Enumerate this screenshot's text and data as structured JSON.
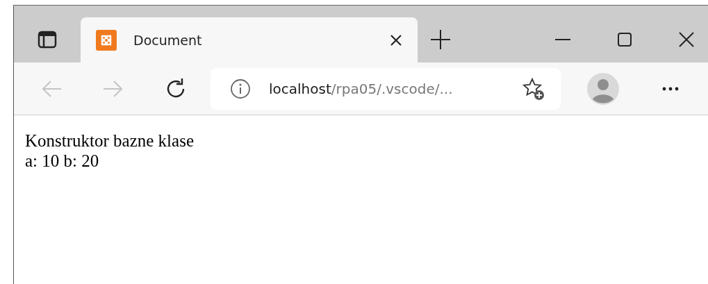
{
  "tabs": [
    {
      "title": "Document",
      "selected": true
    }
  ],
  "address_bar": {
    "host": "localhost",
    "path": "/rpa05/.vscode/..."
  },
  "navigation": {
    "back_disabled": true,
    "forward_disabled": true
  },
  "page": {
    "lines": [
      "Konstruktor bazne klase",
      "a: 10 b: 20"
    ]
  }
}
